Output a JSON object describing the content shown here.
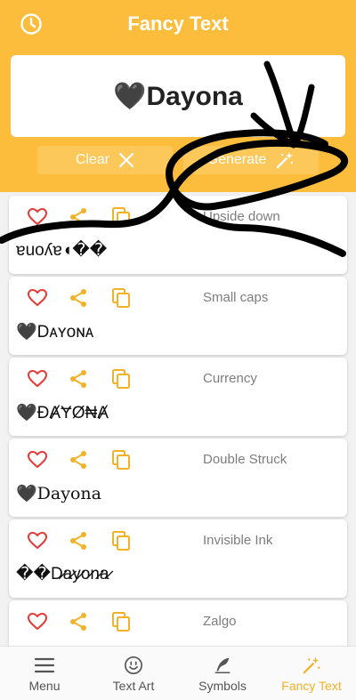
{
  "header": {
    "title": "Fancy Text",
    "input_value": "🖤Dayona",
    "clear_label": "Clear",
    "generate_label": "Generate"
  },
  "styles": [
    {
      "name": "Upside down",
      "output": "ɐuoʎɐ◖��",
      "font": "sans"
    },
    {
      "name": "Small caps",
      "output": "🖤Dᴀʏᴏɴᴀ",
      "font": "sans"
    },
    {
      "name": "Currency",
      "output": "🖤ĐȺɎØ₦Ⱥ",
      "font": "sans"
    },
    {
      "name": "Double Struck",
      "output": "🖤Dayona",
      "font": "serif"
    },
    {
      "name": "Invisible Ink",
      "output": "��D̷a̷y̷o̷n̷a̷",
      "font": "sans"
    },
    {
      "name": "Zalgo",
      "output": "",
      "font": "sans"
    }
  ],
  "nav": [
    {
      "label": "Menu",
      "icon": "menu-icon"
    },
    {
      "label": "Text Art",
      "icon": "smiley-icon"
    },
    {
      "label": "Symbols",
      "icon": "quill-icon"
    },
    {
      "label": "Fancy Text",
      "icon": "magic-wand-icon",
      "active": true
    }
  ],
  "colors": {
    "accent": "#fbbd3b",
    "heart": "#e53935",
    "share": "#f3b126",
    "copy": "#f3b126"
  }
}
